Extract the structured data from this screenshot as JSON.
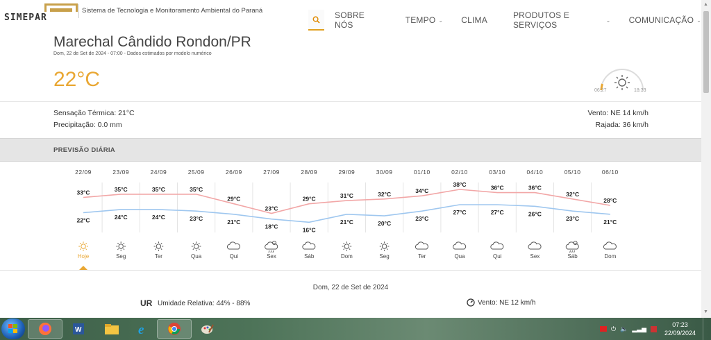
{
  "header": {
    "logo_text": "SIMEPAR",
    "tagline": "Sistema de Tecnologia e Monitoramento Ambiental do Paraná",
    "nav": [
      {
        "label": "SOBRE NÓS",
        "dropdown": false
      },
      {
        "label": "TEMPO",
        "dropdown": true
      },
      {
        "label": "CLIMA",
        "dropdown": false
      },
      {
        "label": "PRODUTOS E SERVIÇOS",
        "dropdown": true
      },
      {
        "label": "COMUNICAÇÃO",
        "dropdown": true
      }
    ]
  },
  "location": {
    "city": "Marechal Cândido Rondon/PR",
    "subtitle": "Dom, 22 de Set de 2024 - 07:00 - Dados estimados por modelo numérico",
    "temperature": "22°C",
    "sunrise": "06:27",
    "sunset": "18:33"
  },
  "conditions": {
    "feels_like": "Sensação Térmica: 21°C",
    "precipitation": "Precipitação: 0.0 mm",
    "wind": "Vento: NE 14 km/h",
    "gust": "Rajada: 36 km/h"
  },
  "forecast": {
    "title": "PREVISÃO DIÁRIA",
    "days": [
      {
        "date": "22/09",
        "max": "33°C",
        "min": "22°C",
        "day": "Hoje",
        "icon": "sun-icon"
      },
      {
        "date": "23/09",
        "max": "35°C",
        "min": "24°C",
        "day": "Seg",
        "icon": "sun-icon"
      },
      {
        "date": "24/09",
        "max": "35°C",
        "min": "24°C",
        "day": "Ter",
        "icon": "sun-icon"
      },
      {
        "date": "25/09",
        "max": "35°C",
        "min": "23°C",
        "day": "Qua",
        "icon": "sun-icon"
      },
      {
        "date": "26/09",
        "max": "29°C",
        "min": "21°C",
        "day": "Qui",
        "icon": "cloud-icon"
      },
      {
        "date": "27/09",
        "max": "23°C",
        "min": "18°C",
        "day": "Sex",
        "icon": "rain-icon"
      },
      {
        "date": "28/09",
        "max": "29°C",
        "min": "16°C",
        "day": "Sáb",
        "icon": "cloud-icon"
      },
      {
        "date": "29/09",
        "max": "31°C",
        "min": "21°C",
        "day": "Dom",
        "icon": "sun-icon"
      },
      {
        "date": "30/09",
        "max": "32°C",
        "min": "20°C",
        "day": "Seg",
        "icon": "sun-icon"
      },
      {
        "date": "01/10",
        "max": "34°C",
        "min": "23°C",
        "day": "Ter",
        "icon": "cloud-icon"
      },
      {
        "date": "02/10",
        "max": "38°C",
        "min": "27°C",
        "day": "Qua",
        "icon": "cloud-icon"
      },
      {
        "date": "03/10",
        "max": "36°C",
        "min": "27°C",
        "day": "Qui",
        "icon": "cloud-icon"
      },
      {
        "date": "04/10",
        "max": "36°C",
        "min": "26°C",
        "day": "Sex",
        "icon": "cloud-icon"
      },
      {
        "date": "05/10",
        "max": "32°C",
        "min": "23°C",
        "day": "Sáb",
        "icon": "rain-icon"
      },
      {
        "date": "06/10",
        "max": "28°C",
        "min": "21°C",
        "day": "Dom",
        "icon": "cloud-icon"
      }
    ],
    "max_values": [
      33,
      35,
      35,
      35,
      29,
      23,
      29,
      31,
      32,
      34,
      38,
      36,
      36,
      32,
      28
    ],
    "min_values": [
      22,
      24,
      24,
      23,
      21,
      18,
      16,
      21,
      20,
      23,
      27,
      27,
      26,
      23,
      21
    ],
    "max_color": "#f2a7a7",
    "min_color": "#9fc7ef",
    "accent_color": "#e9a733"
  },
  "detail": {
    "date": "Dom, 22 de Set de 2024",
    "ur_label": "UR",
    "ur_text": "Umidade Relativa: 44% - 88%",
    "wind": "Vento: NE 12 km/h"
  },
  "taskbar": {
    "time": "07:23",
    "date": "22/09/2024"
  }
}
